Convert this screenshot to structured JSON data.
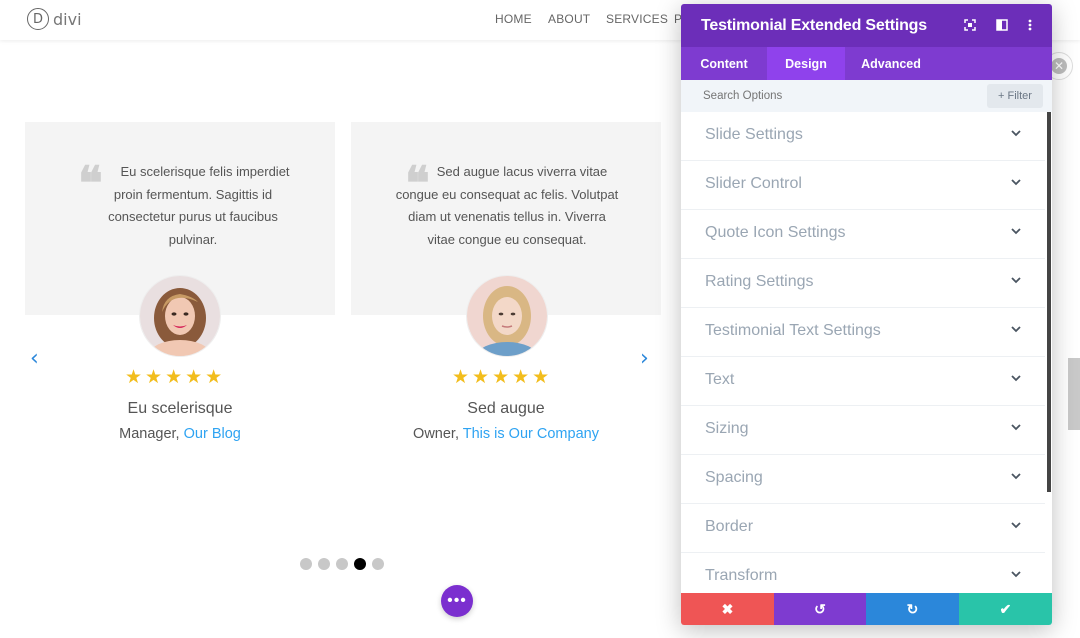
{
  "site": {
    "logo_mark": "D",
    "logo_text": "divi",
    "nav": [
      "HOME",
      "ABOUT",
      "SERVICES",
      "P"
    ]
  },
  "testimonials": [
    {
      "quote_lines": [
        "Eu scelerisque felis imperdiet",
        "proin fermentum. Sagittis id",
        "consectetur purus ut faucibus",
        "pulvinar."
      ],
      "rating": 5,
      "stars": "★★★★★",
      "name": "Eu scelerisque",
      "role": "Manager,",
      "company": "Our Blog"
    },
    {
      "quote_lines": [
        "Sed augue lacus viverra vitae",
        "congue eu consequat ac felis. Volutpat",
        "diam ut venenatis tellus in. Viverra",
        "vitae congue eu consequat."
      ],
      "rating": 5,
      "stars": "★★★★★",
      "name": "Sed augue",
      "role": "Owner,",
      "company": "This is Our Company"
    }
  ],
  "slider": {
    "dot_count": 5,
    "active_dot": 4,
    "prev": "‹",
    "next": "›"
  },
  "fab_label": "•••",
  "panel": {
    "title": "Testimonial Extended Settings",
    "tabs": [
      {
        "label": "Content",
        "active": false
      },
      {
        "label": "Design",
        "active": true
      },
      {
        "label": "Advanced",
        "active": false
      }
    ],
    "search_placeholder": "Search Options",
    "filter_label": "+ Filter",
    "sections": [
      "Slide Settings",
      "Slider Control",
      "Quote Icon Settings",
      "Rating Settings",
      "Testimonial Text Settings",
      "Text",
      "Sizing",
      "Spacing",
      "Border",
      "Transform"
    ],
    "footer": {
      "discard": "✖",
      "undo": "↺",
      "redo": "↻",
      "save": "✔"
    }
  },
  "colors": {
    "panel_header": "#6c2eb9",
    "panel_tabs": "#7e3bd0",
    "tab_active": "#8f42ec",
    "discard": "#ef5555",
    "undo": "#7e3bd0",
    "redo": "#2b87da",
    "save": "#29c4a9",
    "star": "#f2bd1d",
    "link": "#2ea3f2"
  }
}
